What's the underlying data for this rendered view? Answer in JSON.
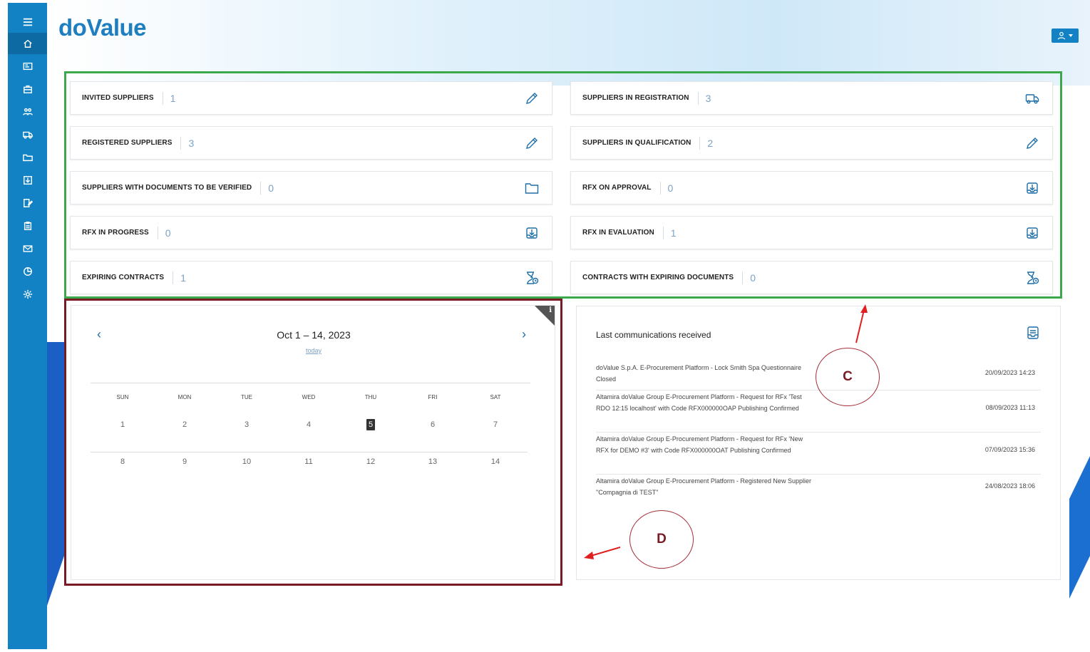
{
  "app": {
    "logo": "doValue"
  },
  "sidebar": {
    "items": [
      {
        "icon": "menu-icon"
      },
      {
        "icon": "home-icon"
      },
      {
        "icon": "id-card-icon"
      },
      {
        "icon": "briefcase-icon"
      },
      {
        "icon": "users-icon"
      },
      {
        "icon": "truck-icon"
      },
      {
        "icon": "folder-icon"
      },
      {
        "icon": "inbox-download-icon"
      },
      {
        "icon": "edit-document-icon"
      },
      {
        "icon": "clipboard-icon"
      },
      {
        "icon": "mail-icon"
      },
      {
        "icon": "chart-pie-icon"
      },
      {
        "icon": "settings-icon"
      }
    ]
  },
  "cards": [
    {
      "label": "INVITED SUPPLIERS",
      "count": "1",
      "icon": "pencil-icon"
    },
    {
      "label": "SUPPLIERS IN REGISTRATION",
      "count": "3",
      "icon": "truck-icon"
    },
    {
      "label": "REGISTERED SUPPLIERS",
      "count": "3",
      "icon": "pencil-icon"
    },
    {
      "label": "SUPPLIERS IN QUALIFICATION",
      "count": "2",
      "icon": "pencil-icon"
    },
    {
      "label": "SUPPLIERS WITH DOCUMENTS TO BE VERIFIED",
      "count": "0",
      "icon": "folder-icon"
    },
    {
      "label": "RFX ON APPROVAL",
      "count": "0",
      "icon": "inbox-download-icon"
    },
    {
      "label": "RFX IN PROGRESS",
      "count": "0",
      "icon": "inbox-download-icon"
    },
    {
      "label": "RFX IN EVALUATION",
      "count": "1",
      "icon": "inbox-download-icon"
    },
    {
      "label": "EXPIRING CONTRACTS",
      "count": "1",
      "icon": "hourglass-clock-icon"
    },
    {
      "label": "CONTRACTS WITH EXPIRING DOCUMENTS",
      "count": "0",
      "icon": "hourglass-clock-icon"
    }
  ],
  "calendar": {
    "title": "Oct 1 – 14, 2023",
    "today_link": "today",
    "prev": "‹",
    "next": "›",
    "weekdays": [
      "SUN",
      "MON",
      "TUE",
      "WED",
      "THU",
      "FRI",
      "SAT"
    ],
    "week1": [
      "1",
      "2",
      "3",
      "4",
      "5",
      "6",
      "7"
    ],
    "week2": [
      "8",
      "9",
      "10",
      "11",
      "12",
      "13",
      "14"
    ],
    "today_day": "5",
    "info": "i"
  },
  "communications": {
    "title": "Last communications received",
    "items": [
      {
        "text": "doValue S.p.A. E-Procurement Platform - Lock Smith Spa Questionnaire Closed",
        "date": "20/09/2023 14:23"
      },
      {
        "text": "Altamira doValue Group E-Procurement Platform - Request for RFx 'Test RDO 12:15 localhost' with Code RFX000000OAP Publishing Confirmed",
        "date": "08/09/2023 11:13"
      },
      {
        "text": "Altamira doValue Group E-Procurement Platform - Request for RFx 'New RFX for DEMO #3' with Code RFX000000OAT Publishing Confirmed",
        "date": "07/09/2023 15:36"
      },
      {
        "text": "Altamira doValue Group E-Procurement Platform - Registered New Supplier \"Compagnia di TEST\"",
        "date": "24/08/2023 18:06"
      }
    ]
  },
  "annotations": {
    "c": "C",
    "d": "D"
  },
  "colors": {
    "brand": "#1282c4",
    "green_box": "#3aa84b",
    "red_box": "#7a1a24"
  }
}
